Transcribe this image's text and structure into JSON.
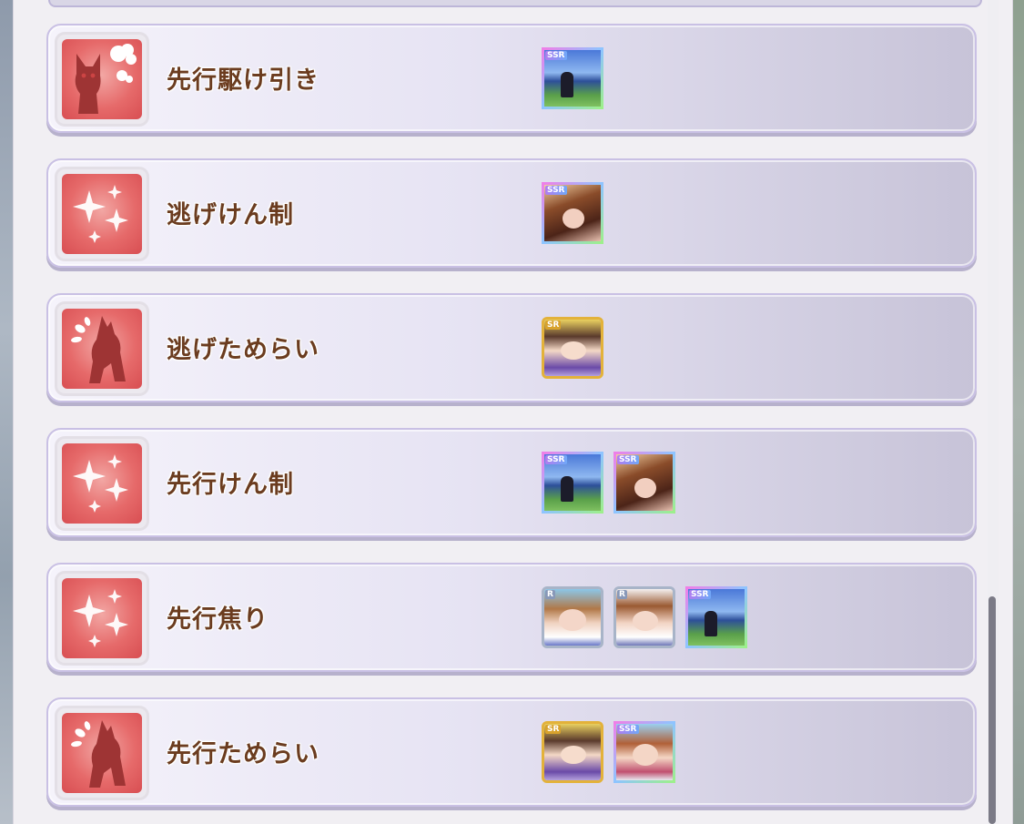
{
  "skills": [
    {
      "name": "先行駆け引き",
      "icon": "horse-puffing-icon",
      "cards": [
        {
          "rarity": "SSR",
          "art": "stadium"
        }
      ]
    },
    {
      "name": "逃げけん制",
      "icon": "sparkle-icon",
      "cards": [
        {
          "rarity": "SSR",
          "art": "brown"
        }
      ]
    },
    {
      "name": "逃げためらい",
      "icon": "horse-sweat-icon",
      "cards": [
        {
          "rarity": "SR",
          "art": "sr"
        }
      ]
    },
    {
      "name": "先行けん制",
      "icon": "sparkle-icon",
      "cards": [
        {
          "rarity": "SSR",
          "art": "stadium"
        },
        {
          "rarity": "SSR",
          "art": "brown"
        }
      ]
    },
    {
      "name": "先行焦り",
      "icon": "sparkle-icon",
      "cards": [
        {
          "rarity": "R",
          "art": "r1"
        },
        {
          "rarity": "R",
          "art": "r2"
        },
        {
          "rarity": "SSR",
          "art": "stadium"
        }
      ]
    },
    {
      "name": "先行ためらい",
      "icon": "horse-sweat-icon",
      "cards": [
        {
          "rarity": "SR",
          "art": "sr"
        },
        {
          "rarity": "SSR",
          "art": "ssr2"
        }
      ]
    }
  ]
}
